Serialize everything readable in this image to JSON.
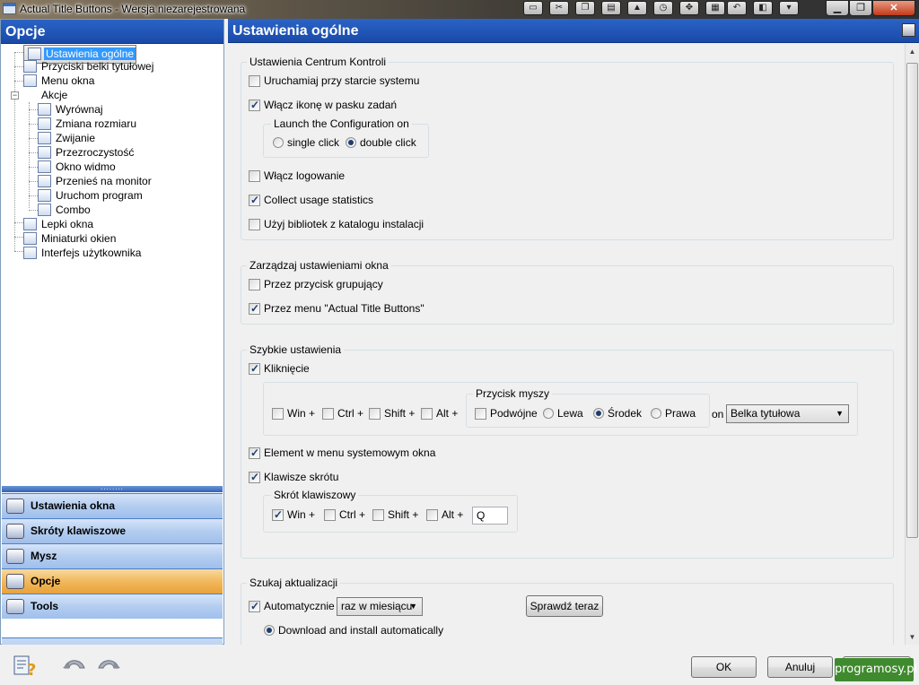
{
  "window": {
    "title": "Actual Title Buttons - Wersja niezarejestrowana"
  },
  "titlebar_icons": [
    "window-icon",
    "cut-icon",
    "copy-icon",
    "paste-icon",
    "bell-icon",
    "clock-icon",
    "move-icon",
    "keyboard-icon",
    "undo-icon",
    "rollup-icon",
    "menu-icon"
  ],
  "left": {
    "header": "Opcje",
    "tree": [
      {
        "label": "Ustawienia ogólne",
        "selected": true
      },
      {
        "label": "Przyciski belki tytułowej"
      },
      {
        "label": "Menu okna"
      },
      {
        "label": "Akcje"
      },
      {
        "label": "Wyrównaj"
      },
      {
        "label": "Zmiana rozmiaru"
      },
      {
        "label": "Zwijanie"
      },
      {
        "label": "Przezroczystość"
      },
      {
        "label": "Okno widmo"
      },
      {
        "label": "Przenieś na monitor"
      },
      {
        "label": "Uruchom program"
      },
      {
        "label": "Combo"
      },
      {
        "label": "Lepki okna"
      },
      {
        "label": "Miniaturki okien"
      },
      {
        "label": "Interfejs użytkownika"
      }
    ],
    "splitter": "........",
    "nav": [
      {
        "label": "Ustawienia okna"
      },
      {
        "label": "Skróty klawiszowe"
      },
      {
        "label": "Mysz"
      },
      {
        "label": "Opcje",
        "active": true
      },
      {
        "label": "Tools"
      }
    ],
    "chevron": "»"
  },
  "right": {
    "header": "Ustawienia ogólne",
    "centrum": {
      "legend": "Ustawienia Centrum Kontroli",
      "startup": "Uruchamiaj przy starcie systemu",
      "tray": "Włącz ikonę w pasku zadań",
      "launch_legend": "Launch the Configuration on",
      "single": "single click",
      "double": "double click",
      "logging": "Włącz logowanie",
      "stats": "Collect usage statistics",
      "libs": "Użyj bibliotek z katalogu instalacji"
    },
    "manage": {
      "legend": "Zarządzaj ustawieniami okna",
      "group_button": "Przez przycisk grupujący",
      "menu": "Przez menu \"Actual Title Buttons\""
    },
    "quick": {
      "legend": "Szybkie ustawienia",
      "click": "Kliknięcie",
      "win": "Win +",
      "ctrl": "Ctrl +",
      "shift": "Shift +",
      "alt": "Alt +",
      "mouse_legend": "Przycisk myszy",
      "double": "Podwójne",
      "left": "Lewa",
      "middle": "Środek",
      "right": "Prawa",
      "on": "on",
      "target": "Belka tytułowa",
      "sysmenu": "Element w menu systemowym okna",
      "hotkeys": "Klawisze skrótu",
      "shortcut_legend": "Skrót klawiszowy",
      "key": "Q"
    },
    "update": {
      "legend": "Szukaj aktualizacji",
      "auto": "Automatycznie",
      "freq": "raz w miesiącu",
      "check": "Sprawdź teraz",
      "download": "Download and install automatically"
    }
  },
  "bottom": {
    "ok": "OK",
    "cancel": "Anuluj",
    "watermark": "programosy.pl"
  }
}
